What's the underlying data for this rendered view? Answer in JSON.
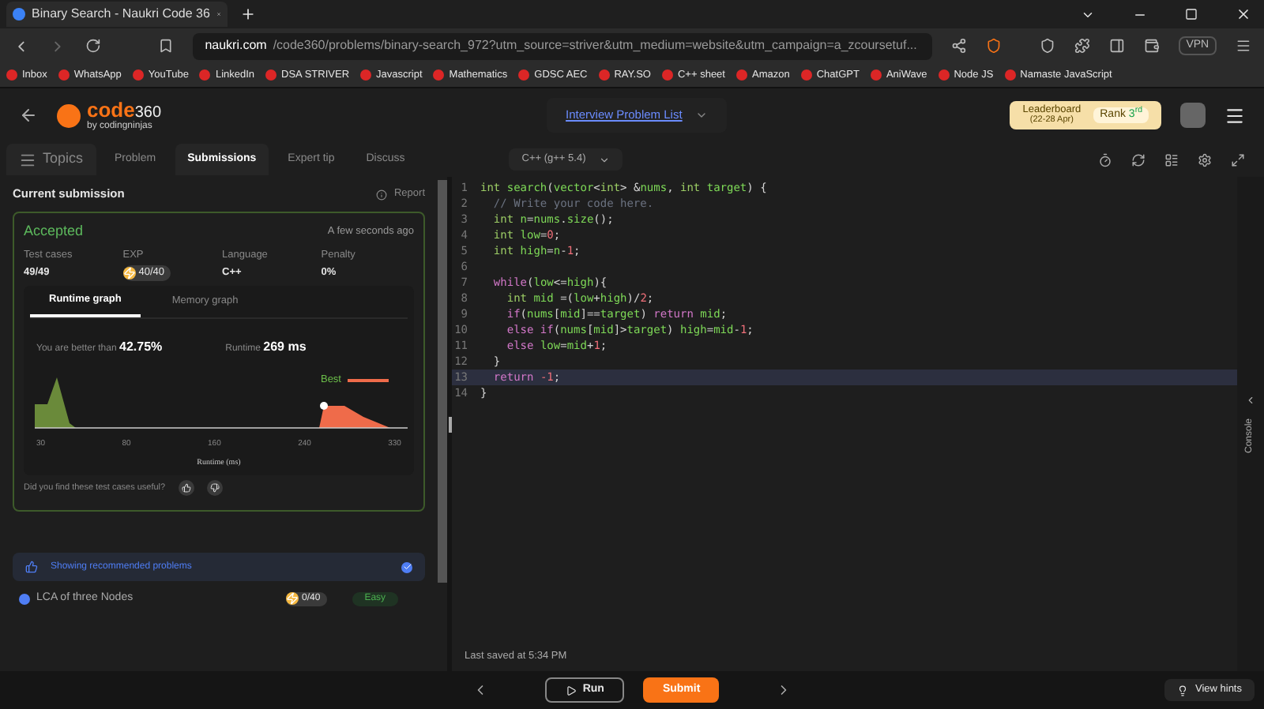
{
  "browser": {
    "tab_title": "Binary Search - Naukri Code 36",
    "url_host": "naukri.com",
    "url_path": "/code360/problems/binary-search_972?utm_source=striver&utm_medium=website&utm_campaign=a_zcoursetuf...",
    "vpn": "VPN",
    "bookmarks": [
      "Inbox",
      "WhatsApp",
      "YouTube",
      "LinkedIn",
      "DSA STRIVER",
      "Javascript",
      "Mathematics",
      "GDSC AEC",
      "RAY.SO",
      "C++ sheet",
      "Amazon",
      "ChatGPT",
      "AniWave",
      "Node JS",
      "Namaste JavaScript"
    ]
  },
  "header": {
    "logo_main": "code",
    "logo_num": "360",
    "logo_sub": "by codingninjas",
    "nav": "Interview Problem List",
    "leaderboard": "Leaderboard",
    "leaderboard_dates": "(22-28 Apr)",
    "rank_label": "Rank",
    "rank": "3$^{rd}$"
  },
  "tabs": [
    {
      "label": "Topics",
      "selected": false
    },
    {
      "label": "Problem",
      "selected": false
    },
    {
      "label": "Submissions",
      "selected": true
    },
    {
      "label": "Expert tip",
      "selected": false
    },
    {
      "label": "Discuss",
      "selected": false
    }
  ],
  "language": "C++ (g++ 5.4)",
  "submission": {
    "title": "Current submission",
    "report": "Report",
    "status": "Accepted",
    "time": "A few seconds ago",
    "stats": [
      {
        "label": "Test cases",
        "value": "49/49",
        "kind": "plain"
      },
      {
        "label": "EXP",
        "value": "40/40",
        "kind": "exp"
      },
      {
        "label": "Language",
        "value": "C++",
        "kind": "plain"
      },
      {
        "label": "Penalty",
        "value": "0%",
        "kind": "plain"
      }
    ],
    "graph_tabs": [
      {
        "label": "Runtime graph",
        "selected": true
      },
      {
        "label": "Memory graph",
        "selected": false
      }
    ],
    "better_label": "You are better than",
    "better_value": "42.75%",
    "runtime_label": "Runtime",
    "runtime_value": "269 ms",
    "best": "Best",
    "x_ticks": [
      "30",
      "80",
      "160",
      "240",
      "330"
    ],
    "x_label": "Runtime (ms)",
    "feedback": "Did you find these test cases useful?"
  },
  "recommend": {
    "label": "Showing recommended problems",
    "checked": true
  },
  "problems": [
    {
      "name": "LCA of three Nodes",
      "exp": "0/40",
      "difficulty": "Easy"
    }
  ],
  "code": [
    {
      "number": "1",
      "highlighted": false,
      "segments": [
        {
          "kind": "type",
          "text": "int "
        },
        {
          "kind": "name",
          "text": "search"
        },
        {
          "kind": "punct",
          "text": "("
        },
        {
          "kind": "name",
          "text": "vector"
        },
        {
          "kind": "punct",
          "text": "<"
        },
        {
          "kind": "type",
          "text": "int"
        },
        {
          "kind": "punct",
          "text": "> &"
        },
        {
          "kind": "name",
          "text": "nums"
        },
        {
          "kind": "punct",
          "text": ", "
        },
        {
          "kind": "type",
          "text": "int "
        },
        {
          "kind": "name",
          "text": "target"
        },
        {
          "kind": "punct",
          "text": ") {"
        }
      ]
    },
    {
      "number": "2",
      "highlighted": false,
      "segments": [
        {
          "kind": "comment",
          "text": "  // Write your code here."
        }
      ]
    },
    {
      "number": "3",
      "highlighted": false,
      "segments": [
        {
          "kind": "type",
          "text": "  int "
        },
        {
          "kind": "name",
          "text": "n"
        },
        {
          "kind": "punct",
          "text": "="
        },
        {
          "kind": "name",
          "text": "nums"
        },
        {
          "kind": "punct",
          "text": "."
        },
        {
          "kind": "name",
          "text": "size"
        },
        {
          "kind": "punct",
          "text": "();"
        }
      ]
    },
    {
      "number": "4",
      "highlighted": false,
      "segments": [
        {
          "kind": "type",
          "text": "  int "
        },
        {
          "kind": "name",
          "text": "low"
        },
        {
          "kind": "punct",
          "text": "="
        },
        {
          "kind": "number",
          "text": "0"
        },
        {
          "kind": "punct",
          "text": ";"
        }
      ]
    },
    {
      "number": "5",
      "highlighted": false,
      "segments": [
        {
          "kind": "type",
          "text": "  int "
        },
        {
          "kind": "name",
          "text": "high"
        },
        {
          "kind": "punct",
          "text": "="
        },
        {
          "kind": "name",
          "text": "n"
        },
        {
          "kind": "punct",
          "text": "-"
        },
        {
          "kind": "number",
          "text": "1"
        },
        {
          "kind": "punct",
          "text": ";"
        }
      ]
    },
    {
      "number": "6",
      "highlighted": false
    },
    {
      "number": "7",
      "highlighted": false,
      "segments": [
        {
          "kind": "keyword",
          "text": "  while"
        },
        {
          "kind": "punct",
          "text": "("
        },
        {
          "kind": "name",
          "text": "low"
        },
        {
          "kind": "punct",
          "text": "<="
        },
        {
          "kind": "name",
          "text": "high"
        },
        {
          "kind": "punct",
          "text": "){"
        }
      ]
    },
    {
      "number": "8",
      "highlighted": false,
      "segments": [
        {
          "kind": "type",
          "text": "    int "
        },
        {
          "kind": "name",
          "text": "mid "
        },
        {
          "kind": "punct",
          "text": "=("
        },
        {
          "kind": "name",
          "text": "low"
        },
        {
          "kind": "punct",
          "text": "+"
        },
        {
          "kind": "name",
          "text": "high"
        },
        {
          "kind": "punct",
          "text": ")/"
        },
        {
          "kind": "number",
          "text": "2"
        },
        {
          "kind": "punct",
          "text": ";"
        }
      ]
    },
    {
      "number": "9",
      "highlighted": false,
      "segments": [
        {
          "kind": "keyword",
          "text": "    if"
        },
        {
          "kind": "punct",
          "text": "("
        },
        {
          "kind": "name",
          "text": "nums"
        },
        {
          "kind": "punct",
          "text": "["
        },
        {
          "kind": "name",
          "text": "mid"
        },
        {
          "kind": "punct",
          "text": "]=="
        },
        {
          "kind": "name",
          "text": "target"
        },
        {
          "kind": "punct",
          "text": ") "
        },
        {
          "kind": "keyword",
          "text": "return "
        },
        {
          "kind": "name",
          "text": "mid"
        },
        {
          "kind": "punct",
          "text": ";"
        }
      ]
    },
    {
      "number": "10",
      "highlighted": false,
      "segments": [
        {
          "kind": "keyword",
          "text": "    else if"
        },
        {
          "kind": "punct",
          "text": "("
        },
        {
          "kind": "name",
          "text": "nums"
        },
        {
          "kind": "punct",
          "text": "["
        },
        {
          "kind": "name",
          "text": "mid"
        },
        {
          "kind": "punct",
          "text": "]>"
        },
        {
          "kind": "name",
          "text": "target"
        },
        {
          "kind": "punct",
          "text": ") "
        },
        {
          "kind": "name",
          "text": "high"
        },
        {
          "kind": "punct",
          "text": "="
        },
        {
          "kind": "name",
          "text": "mid"
        },
        {
          "kind": "punct",
          "text": "-"
        },
        {
          "kind": "number",
          "text": "1"
        },
        {
          "kind": "punct",
          "text": ";"
        }
      ]
    },
    {
      "number": "11",
      "highlighted": false,
      "segments": [
        {
          "kind": "keyword",
          "text": "    else "
        },
        {
          "kind": "name",
          "text": "low"
        },
        {
          "kind": "punct",
          "text": "="
        },
        {
          "kind": "name",
          "text": "mid"
        },
        {
          "kind": "punct",
          "text": "+"
        },
        {
          "kind": "number",
          "text": "1"
        },
        {
          "kind": "punct",
          "text": ";"
        }
      ]
    },
    {
      "number": "12",
      "highlighted": false,
      "segments": [
        {
          "kind": "punct",
          "text": "  }"
        }
      ]
    },
    {
      "number": "13",
      "highlighted": true,
      "segments": [
        {
          "kind": "keyword",
          "text": "  return "
        },
        {
          "kind": "number",
          "text": "-1"
        },
        {
          "kind": "punct",
          "text": ";"
        }
      ]
    },
    {
      "number": "14",
      "highlighted": false,
      "segments": [
        {
          "kind": "punct",
          "text": "}"
        }
      ]
    }
  ],
  "last_saved": "Last saved at 5:34 PM",
  "run": "Run",
  "submit": "Submit",
  "console": "Console",
  "hints": "View hints"
}
